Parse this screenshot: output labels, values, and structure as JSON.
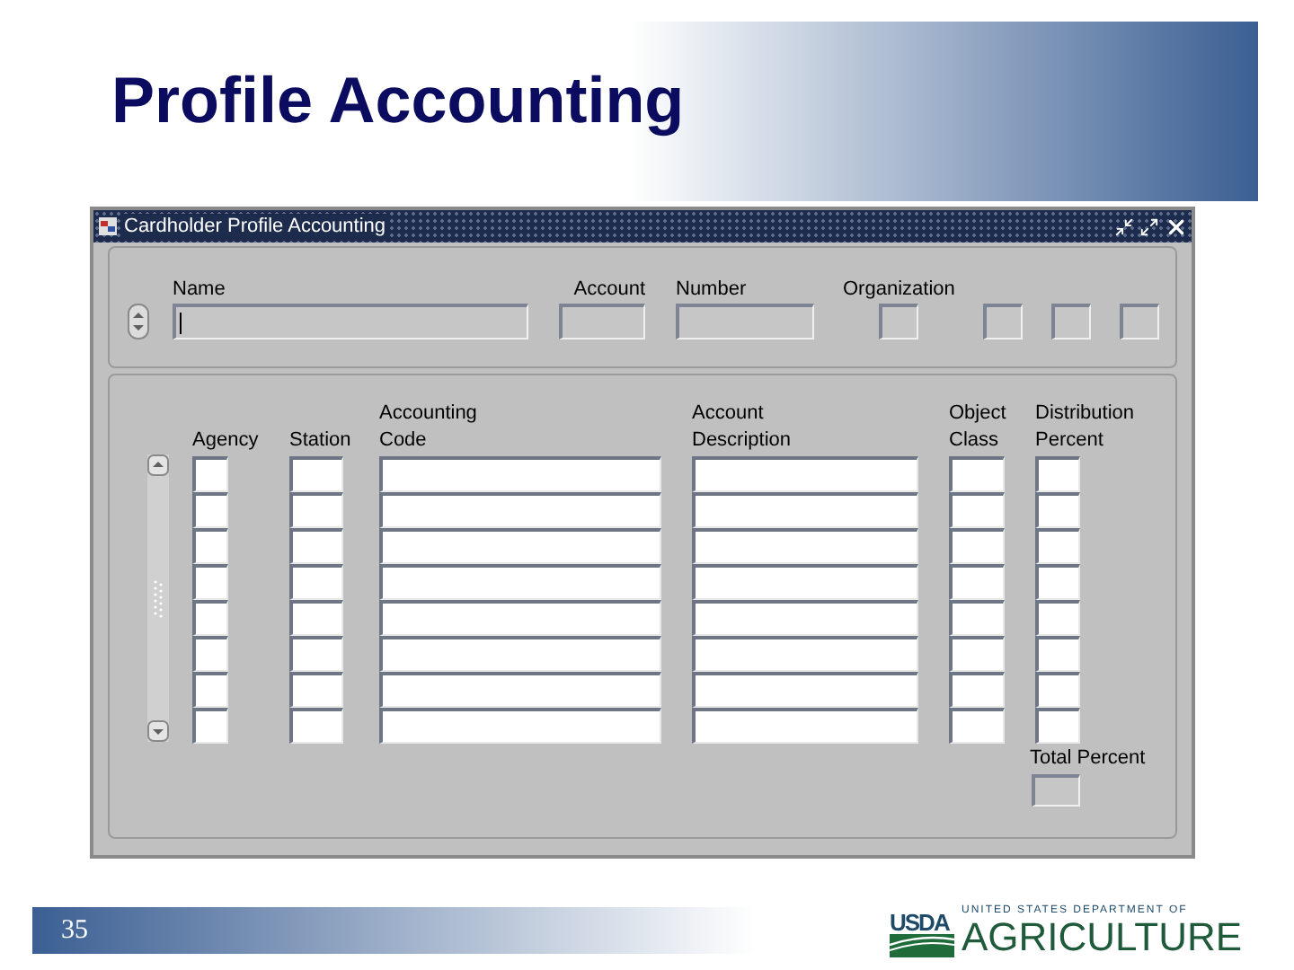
{
  "slide": {
    "title": "Profile Accounting",
    "page_number": "35"
  },
  "window": {
    "title": "Cardholder Profile Accounting"
  },
  "header_fields": [
    {
      "label": "Name"
    },
    {
      "label": "Account"
    },
    {
      "label": "Number"
    },
    {
      "label": "Organization"
    }
  ],
  "table": {
    "columns": [
      {
        "label_lines": [
          "Agency"
        ]
      },
      {
        "label_lines": [
          "Station"
        ]
      },
      {
        "label_lines": [
          "Accounting",
          "Code"
        ]
      },
      {
        "label_lines": [
          "Account",
          "Description"
        ]
      },
      {
        "label_lines": [
          "Object",
          "Class"
        ]
      },
      {
        "label_lines": [
          "Distribution",
          "Percent"
        ]
      }
    ],
    "total": {
      "label": "Total Percent"
    }
  },
  "logo": {
    "mark": "USDA",
    "line_1": "UNITED STATES DEPARTMENT OF",
    "line_2": "AGRICULTURE"
  }
}
